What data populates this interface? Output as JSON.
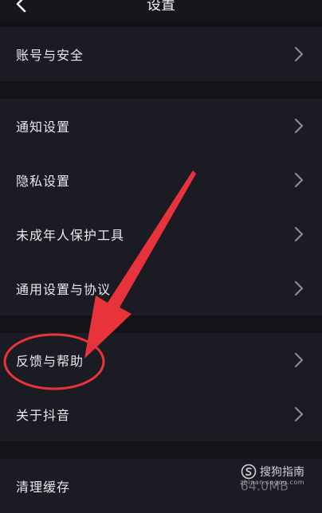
{
  "header": {
    "title": "设置"
  },
  "groups": [
    {
      "items": [
        {
          "label": "账号与安全"
        }
      ]
    },
    {
      "items": [
        {
          "label": "通知设置"
        },
        {
          "label": "隐私设置"
        },
        {
          "label": "未成年人保护工具"
        },
        {
          "label": "通用设置与协议"
        }
      ]
    },
    {
      "items": [
        {
          "label": "反馈与帮助"
        },
        {
          "label": "关于抖音"
        }
      ]
    },
    {
      "items": [
        {
          "label": "清理缓存",
          "value": "64.0MB"
        }
      ]
    }
  ],
  "watermark": {
    "brand": "搜狗指南",
    "url": "zhinan.sogou.com"
  },
  "colors": {
    "background": "#121217",
    "row_background": "#1b1b24",
    "annotation_red": "#e8333a"
  }
}
